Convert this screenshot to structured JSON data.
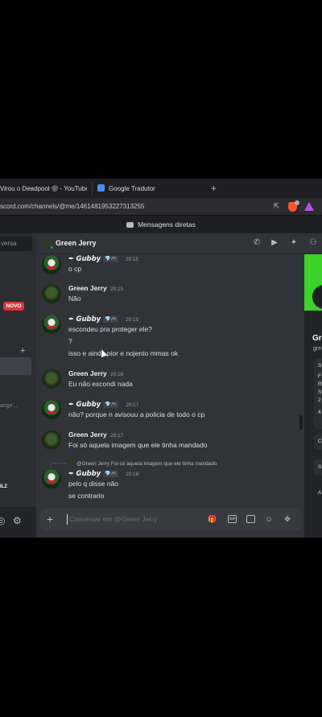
{
  "browser": {
    "tabs": [
      {
        "label": "Virou o Deadpool 😝 - YouTube"
      },
      {
        "label": "Google Tradutor"
      }
    ],
    "new_tab": "+",
    "url": "scord.com/channels/@me/1461481953227313255"
  },
  "title_bar": {
    "label": "Mensagens diretas"
  },
  "sidebar": {
    "conversation_label": "versa",
    "new_badge": "NOVO",
    "add": "+",
    "fragment": "ange'...",
    "user_fragment": "ILZ"
  },
  "header": {
    "name": "Green Jerry",
    "status_color": "#23a55a"
  },
  "messages": [
    {
      "author": "✒ 𝙂𝙪𝙗𝙗𝙮",
      "badge": "💎🎮",
      "time": "20:15",
      "lines": [
        "o cp"
      ]
    },
    {
      "author": "Green Jerry",
      "time": "20:15",
      "lines": [
        "Não"
      ]
    },
    {
      "author": "✒ 𝙂𝙪𝙗𝙗𝙮",
      "badge": "💎🎮",
      "time": "20:15",
      "lines": [
        "escondeu pra proteger ele?",
        "?",
        "isso e ainda pior e nojento mmas ok"
      ]
    },
    {
      "author": "Green Jerry",
      "time": "20:16",
      "lines": [
        "Eu não escondi nada"
      ]
    },
    {
      "author": "✒ 𝙂𝙪𝙗𝙗𝙮",
      "badge": "💎🎮",
      "time": "20:17",
      "lines": [
        "não? porque n avisouu a policia de todo o cp"
      ]
    },
    {
      "author": "Green Jerry",
      "time": "20:17",
      "lines": [
        "Foi só aquela imagem que ele tinha mandado"
      ]
    },
    {
      "reply_to": "@Green Jerry Foi só aquela imagem que ele tinha mandado",
      "author": "✒ 𝙂𝙪𝙗𝙗𝙮",
      "badge": "💎🎮",
      "time": "20:18",
      "lines": [
        "pelo q disse não",
        "se contrario"
      ]
    }
  ],
  "composer": {
    "placeholder": "Conversar em @Green Jerry",
    "plus": "+",
    "gif": "GIF"
  },
  "profile": {
    "name": "Gr",
    "handle": "gre",
    "card_lines": [
      "S",
      "F",
      "R",
      "S",
      "2",
      "4"
    ],
    "row_labels": [
      "C",
      "S",
      "A"
    ],
    "banner_color": "#3bd22a"
  }
}
